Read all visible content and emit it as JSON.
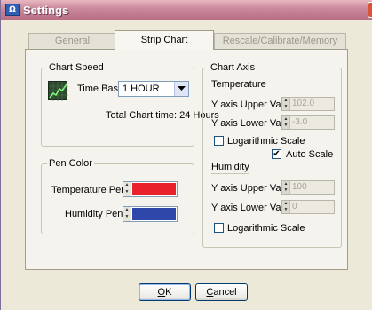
{
  "window": {
    "title": "Settings"
  },
  "tabs": [
    "General",
    "Strip Chart",
    "Rescale/Calibrate/Memory"
  ],
  "chart_speed": {
    "legend": "Chart Speed",
    "time_base_label": "Time Base :",
    "time_base_value": "1 HOUR",
    "total_chart_time": "Total Chart time: 24 Hours"
  },
  "pen_color": {
    "legend": "Pen Color",
    "temperature_label": "Temperature Pen :",
    "humidity_label": "Humidity Pen :",
    "temperature_color": "#e8212b",
    "humidity_color": "#2f47a8"
  },
  "chart_axis": {
    "legend": "Chart Axis",
    "temperature": {
      "label": "Temperature",
      "upper_label": "Y axis Upper Value :",
      "upper_value": "102.0",
      "lower_label": "Y axis Lower Value :",
      "lower_value": "-3.0",
      "log_label": "Logarithmic Scale",
      "log_checked": false,
      "auto_label": "Auto Scale",
      "auto_checked": true
    },
    "humidity": {
      "label": "Humidity",
      "upper_label": "Y axis Upper Value :",
      "upper_value": "100",
      "lower_label": "Y axis Lower Value :",
      "lower_value": "0",
      "log_label": "Logarithmic Scale",
      "log_checked": false
    }
  },
  "buttons": {
    "ok_mnemonic": "O",
    "ok_rest": "K",
    "cancel_mnemonic": "C",
    "cancel_rest": "ancel"
  },
  "checkmark": "✔"
}
